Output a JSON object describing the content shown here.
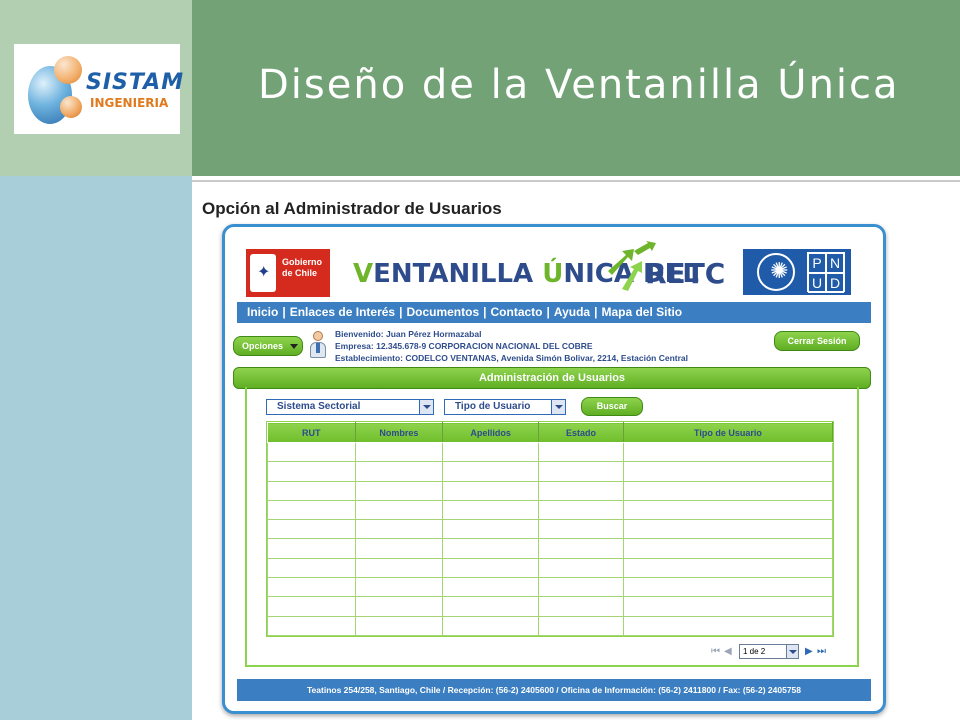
{
  "slide": {
    "title": "Diseño de la Ventanilla Única",
    "section_heading": "Opción al Administrador de Usuarios",
    "logo": {
      "brand": "SISTAM",
      "sub": "INGENIERIA"
    }
  },
  "app": {
    "gob_logo_text_1": "Gobierno",
    "gob_logo_text_2": "de Chile",
    "title_part1": "V",
    "title_part2": "ENTANILLA ",
    "title_part3": "Ú",
    "title_part4": "NICA DEL",
    "retc": "RETC",
    "pnud_letters": [
      "P",
      "N",
      "U",
      "D"
    ],
    "nav": [
      "Inicio",
      "Enlaces de Interés",
      "Documentos",
      "Contacto",
      "Ayuda",
      "Mapa del Sitio"
    ],
    "opciones_label": "Opciones",
    "user": {
      "welcome": "Bienvenido: Juan Pérez Hormazabal",
      "company": "Empresa: 12.345.678-9 CORPORACION NACIONAL DEL COBRE",
      "establishment": "Establecimiento: CODELCO VENTANAS, Avenida Simón Bolivar, 2214, Estación Central"
    },
    "logout_label": "Cerrar Sesión",
    "section_bar": "Administración de Usuarios",
    "filters": {
      "sistema": "Sistema Sectorial",
      "tipo": "Tipo de Usuario",
      "search_label": "Buscar"
    },
    "table": {
      "columns": [
        "RUT",
        "Nombres",
        "Apellidos",
        "Estado",
        "Tipo de Usuario"
      ],
      "empty_rows": 10
    },
    "pager": {
      "page": "1 de 2"
    },
    "footer": "Teatinos 254/258, Santiago, Chile / Recepción: (56-2) 2405600 / Oficina de Información: (56-2) 2411800 / Fax: (56-2) 2405758"
  },
  "colors": {
    "title_band": "#72a276",
    "left_top": "#b3cfb2",
    "left_bottom": "#a8ced9",
    "accent_green": "#6fb52c",
    "accent_blue": "#3b7fc2"
  },
  "icons": [
    "shield-icon",
    "un-emblem-icon",
    "arrows-icon",
    "caret-down-icon",
    "user-avatar-icon",
    "first-page-icon",
    "prev-page-icon",
    "next-page-icon",
    "last-page-icon"
  ]
}
